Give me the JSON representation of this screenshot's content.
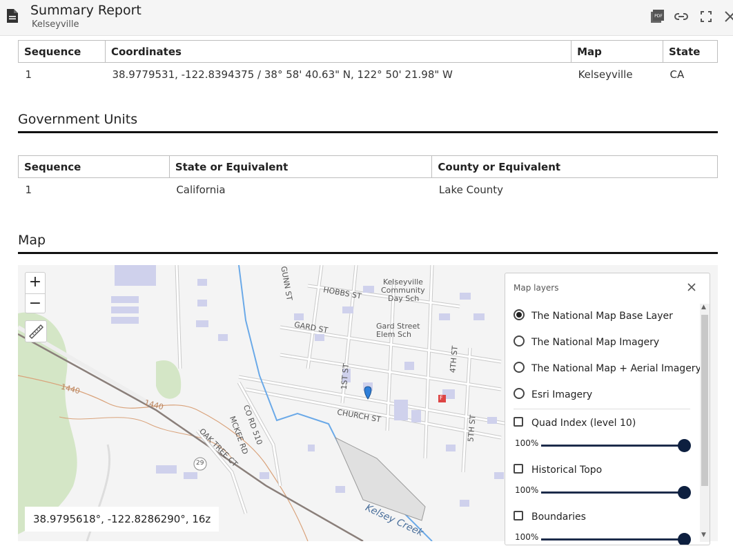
{
  "header": {
    "title": "Summary Report",
    "subtitle": "Kelseyville",
    "icons": [
      "document-icon",
      "pdf-icon",
      "link-icon",
      "fullscreen-icon",
      "close-icon"
    ]
  },
  "coordinates_table": {
    "headers": [
      "Sequence",
      "Coordinates",
      "Map",
      "State"
    ],
    "rows": [
      [
        "1",
        "38.9779531, -122.8394375 / 38° 58' 40.63\" N, 122° 50' 21.98\" W",
        "Kelseyville",
        "CA"
      ]
    ]
  },
  "government_units": {
    "title": "Government Units",
    "headers": [
      "Sequence",
      "State or Equivalent",
      "County or Equivalent"
    ],
    "rows": [
      [
        "1",
        "California",
        "Lake County"
      ]
    ]
  },
  "map_section": {
    "title": "Map",
    "zoom_in": "+",
    "zoom_out": "−",
    "coord_readout": "38.9795618°, -122.8286290°, 16z",
    "labels": {
      "school1_a": "Kelseyville",
      "school1_b": "Community",
      "school1_c": "Day Sch",
      "school2_a": "Gard Street",
      "school2_b": "Elem Sch",
      "hobbs": "HOBBS ST",
      "gard": "GARD ST",
      "gunn": "GUNN ST",
      "church": "CHURCH ST",
      "first": "1ST ST",
      "fourth": "4TH ST",
      "fifth": "5TH ST",
      "corard": "CO RD 510",
      "mckee": "MCKEE RD",
      "oak": "OAK TREE CT",
      "creek": "Kelsey Creek",
      "contour1": "1440",
      "contour2": "1440",
      "highway": "29",
      "fire": "F"
    }
  },
  "layers_panel": {
    "title": "Map layers",
    "base_layers": [
      {
        "label": "The National Map Base Layer",
        "selected": true
      },
      {
        "label": "The National Map Imagery",
        "selected": false
      },
      {
        "label": "The National Map + Aerial Imagery",
        "selected": false
      },
      {
        "label": "Esri Imagery",
        "selected": false
      }
    ],
    "overlays": [
      {
        "label": "Quad Index (level 10)",
        "checked": false,
        "opacity": "100%"
      },
      {
        "label": "Historical Topo",
        "checked": false,
        "opacity": "100%"
      },
      {
        "label": "Boundaries",
        "checked": false,
        "opacity": "100%"
      }
    ]
  },
  "colors": {
    "accent": "#0d1f3f",
    "water": "#6aa9e8",
    "building": "#cfd1ec",
    "green": "#d4e6c6",
    "contour": "#d9a27a"
  }
}
